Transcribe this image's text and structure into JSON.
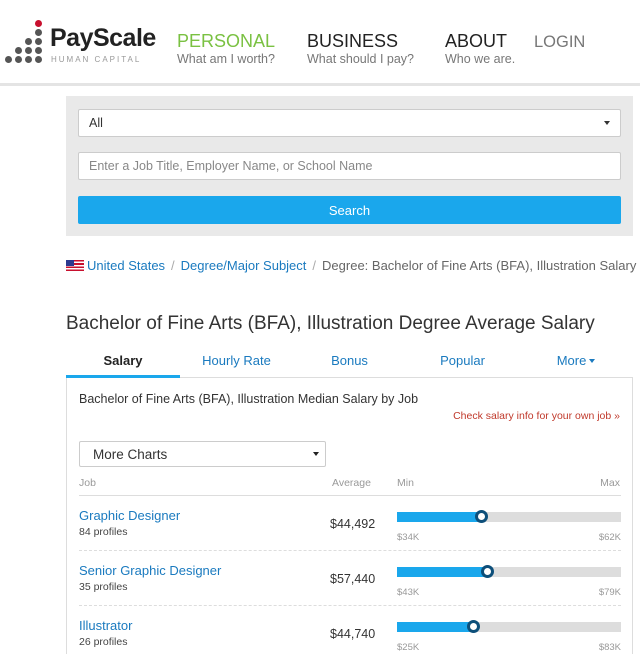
{
  "header": {
    "logo": {
      "name": "PayScale",
      "tagline": "HUMAN CAPITAL"
    },
    "nav": [
      {
        "title": "PERSONAL",
        "subtitle": "What am I worth?"
      },
      {
        "title": "BUSINESS",
        "subtitle": "What should I pay?"
      },
      {
        "title": "ABOUT",
        "subtitle": "Who we are."
      }
    ],
    "login": "LOGIN",
    "accent_color": "#7ac142"
  },
  "search": {
    "category_selected": "All",
    "query_placeholder": "Enter a Job Title, Employer Name, or School Name",
    "query_value": "",
    "button_label": "Search",
    "button_color": "#1aa7ec"
  },
  "breadcrumb": {
    "items": [
      "United States",
      "Degree/Major Subject"
    ],
    "current": "Degree: Bachelor of Fine Arts (BFA), Illustration Salary"
  },
  "page_title": "Bachelor of Fine Arts (BFA), Illustration Degree Average Salary",
  "tabs": [
    "Salary",
    "Hourly Rate",
    "Bonus",
    "Popular",
    "More"
  ],
  "active_tab": "Salary",
  "panel": {
    "title": "Bachelor of Fine Arts (BFA), Illustration Median Salary by Job",
    "own_link": "Check salary info for your own job »",
    "charts_select": "More Charts",
    "columns": {
      "job": "Job",
      "average": "Average",
      "min": "Min",
      "max": "Max"
    },
    "rows": [
      {
        "job": "Graphic Designer",
        "profiles": "84 profiles",
        "average": "$44,492",
        "min": "$34K",
        "max": "$62K",
        "min_value": 34,
        "max_value": 62,
        "avg_value": 44.492
      },
      {
        "job": "Senior Graphic Designer",
        "profiles": "35 profiles",
        "average": "$57,440",
        "min": "$43K",
        "max": "$79K",
        "min_value": 43,
        "max_value": 79,
        "avg_value": 57.44
      },
      {
        "job": "Illustrator",
        "profiles": "26 profiles",
        "average": "$44,740",
        "min": "$25K",
        "max": "$83K",
        "min_value": 25,
        "max_value": 83,
        "avg_value": 44.74
      }
    ]
  }
}
